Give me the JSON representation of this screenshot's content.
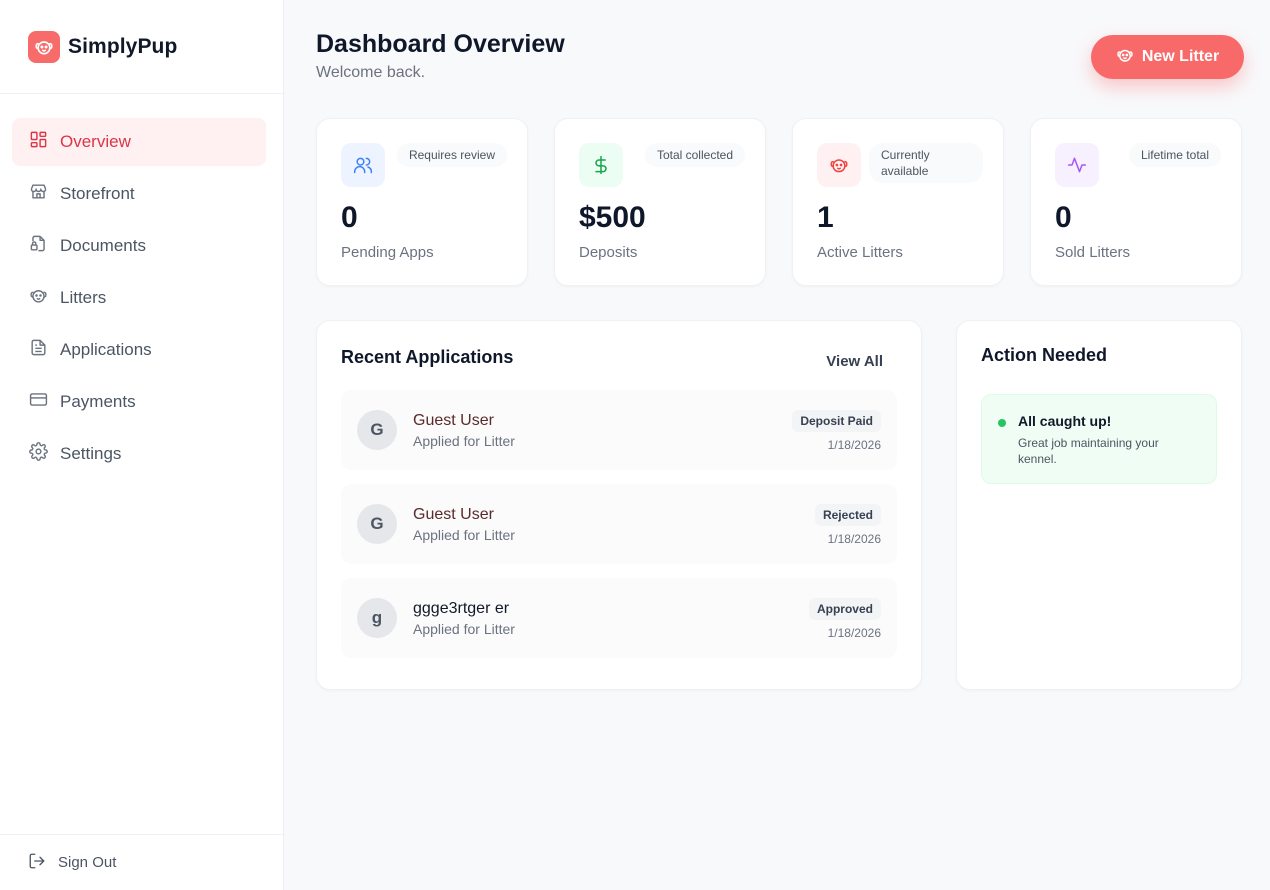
{
  "app": {
    "name": "SimplyPup"
  },
  "sidebar": {
    "items": [
      {
        "label": "Overview",
        "icon": "grid-icon",
        "active": true
      },
      {
        "label": "Storefront",
        "icon": "store-icon"
      },
      {
        "label": "Documents",
        "icon": "document-lock-icon"
      },
      {
        "label": "Litters",
        "icon": "dog-icon"
      },
      {
        "label": "Applications",
        "icon": "file-text-icon"
      },
      {
        "label": "Payments",
        "icon": "credit-card-icon"
      },
      {
        "label": "Settings",
        "icon": "gear-icon"
      }
    ],
    "sign_out": "Sign Out"
  },
  "header": {
    "title": "Dashboard Overview",
    "subtitle": "Welcome back.",
    "new_litter_label": "New Litter"
  },
  "stats": [
    {
      "badge": "Requires review",
      "value": "0",
      "label": "Pending Apps",
      "icon": "users-icon",
      "color": "#3b82f6",
      "bg": "#eef4ff"
    },
    {
      "badge": "Total collected",
      "value": "$500",
      "label": "Deposits",
      "icon": "dollar-icon",
      "color": "#16a34a",
      "bg": "#ecfdf3"
    },
    {
      "badge": "Currently available",
      "value": "1",
      "label": "Active Litters",
      "icon": "dog-icon",
      "color": "#ef4444",
      "bg": "#fff1f1"
    },
    {
      "badge": "Lifetime total",
      "value": "0",
      "label": "Sold Litters",
      "icon": "activity-icon",
      "color": "#a855f7",
      "bg": "#f7f0ff"
    }
  ],
  "recent": {
    "title": "Recent Applications",
    "view_all": "View All",
    "rows": [
      {
        "initial": "G",
        "name": "Guest User",
        "sub": "Applied for Litter",
        "status": "Deposit Paid",
        "date": "1/18/2026"
      },
      {
        "initial": "G",
        "name": "Guest User",
        "sub": "Applied for Litter",
        "status": "Rejected",
        "date": "1/18/2026"
      },
      {
        "initial": "g",
        "name": "ggge3rtger er",
        "sub": "Applied for Litter",
        "status": "Approved",
        "date": "1/18/2026"
      }
    ]
  },
  "action": {
    "title": "Action Needed",
    "status_title": "All caught up!",
    "status_text": "Great job maintaining your kennel."
  },
  "colors": {
    "accent": "#f86a6a",
    "active_text": "#dc3545",
    "success": "#22c55e"
  }
}
